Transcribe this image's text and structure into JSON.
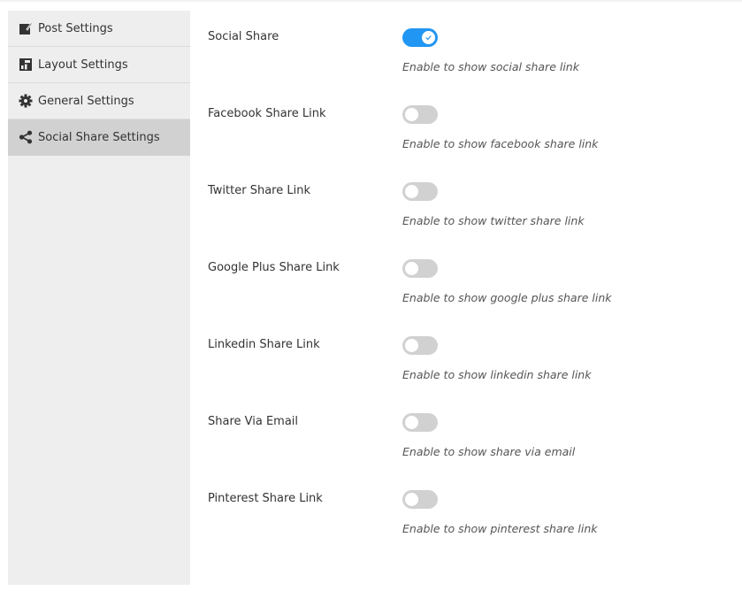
{
  "sidebar": {
    "items": [
      {
        "label": "Post Settings",
        "icon": "edit-icon",
        "active": false
      },
      {
        "label": "Layout Settings",
        "icon": "layout-icon",
        "active": false
      },
      {
        "label": "General Settings",
        "icon": "gear-icon",
        "active": false
      },
      {
        "label": "Social Share Settings",
        "icon": "share-icon",
        "active": true
      }
    ]
  },
  "settings": {
    "rows": [
      {
        "label": "Social Share",
        "enabled": true,
        "description": "Enable to show social share link"
      },
      {
        "label": "Facebook Share Link",
        "enabled": false,
        "description": "Enable to show facebook share link"
      },
      {
        "label": "Twitter Share Link",
        "enabled": false,
        "description": "Enable to show twitter share link"
      },
      {
        "label": "Google Plus Share Link",
        "enabled": false,
        "description": "Enable to show google plus share link"
      },
      {
        "label": "Linkedin Share Link",
        "enabled": false,
        "description": "Enable to show linkedin share link"
      },
      {
        "label": "Share Via Email",
        "enabled": false,
        "description": "Enable to show share via email"
      },
      {
        "label": "Pinterest Share Link",
        "enabled": false,
        "description": "Enable to show pinterest share link"
      }
    ]
  },
  "colors": {
    "toggle_on": "#2196f3",
    "toggle_off": "#d1d1d1",
    "sidebar_bg": "#eeeeee",
    "sidebar_active": "#d1d1d1"
  }
}
